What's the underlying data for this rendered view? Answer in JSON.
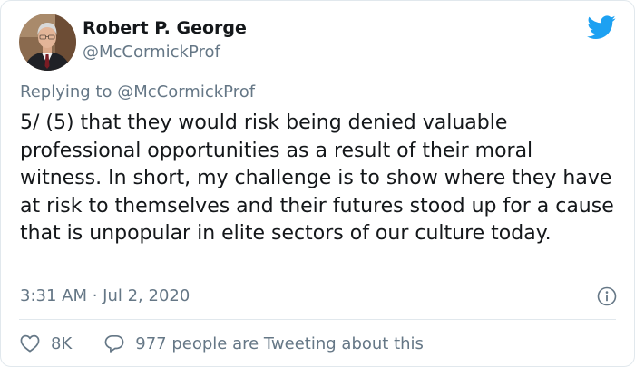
{
  "tweet": {
    "author": {
      "display_name": "Robert P. George",
      "handle": "@McCormickProf",
      "avatar_icon": "profile-photo"
    },
    "brand_icon": "twitter-bird-icon",
    "brand_color": "#1da1f2",
    "replying_to": {
      "prefix": "Replying to",
      "handle": "@McCormickProf"
    },
    "text": "5/ (5) that they would risk being denied valuable professional opportunities as a result of their moral witness. In short, my challenge is to show where they have at risk to themselves and their futures stood up for a cause that is unpopular in elite sectors of our culture today.",
    "timestamp": "3:31 AM · Jul 2, 2020",
    "info_icon": "info-icon",
    "likes": {
      "icon": "heart-icon",
      "count": "8K"
    },
    "conversation": {
      "icon": "speech-bubble-icon",
      "text": "977 people are Tweeting about this"
    }
  },
  "colors": {
    "text_primary": "#14171a",
    "text_secondary": "#657786",
    "divider": "#e1e8ed"
  }
}
